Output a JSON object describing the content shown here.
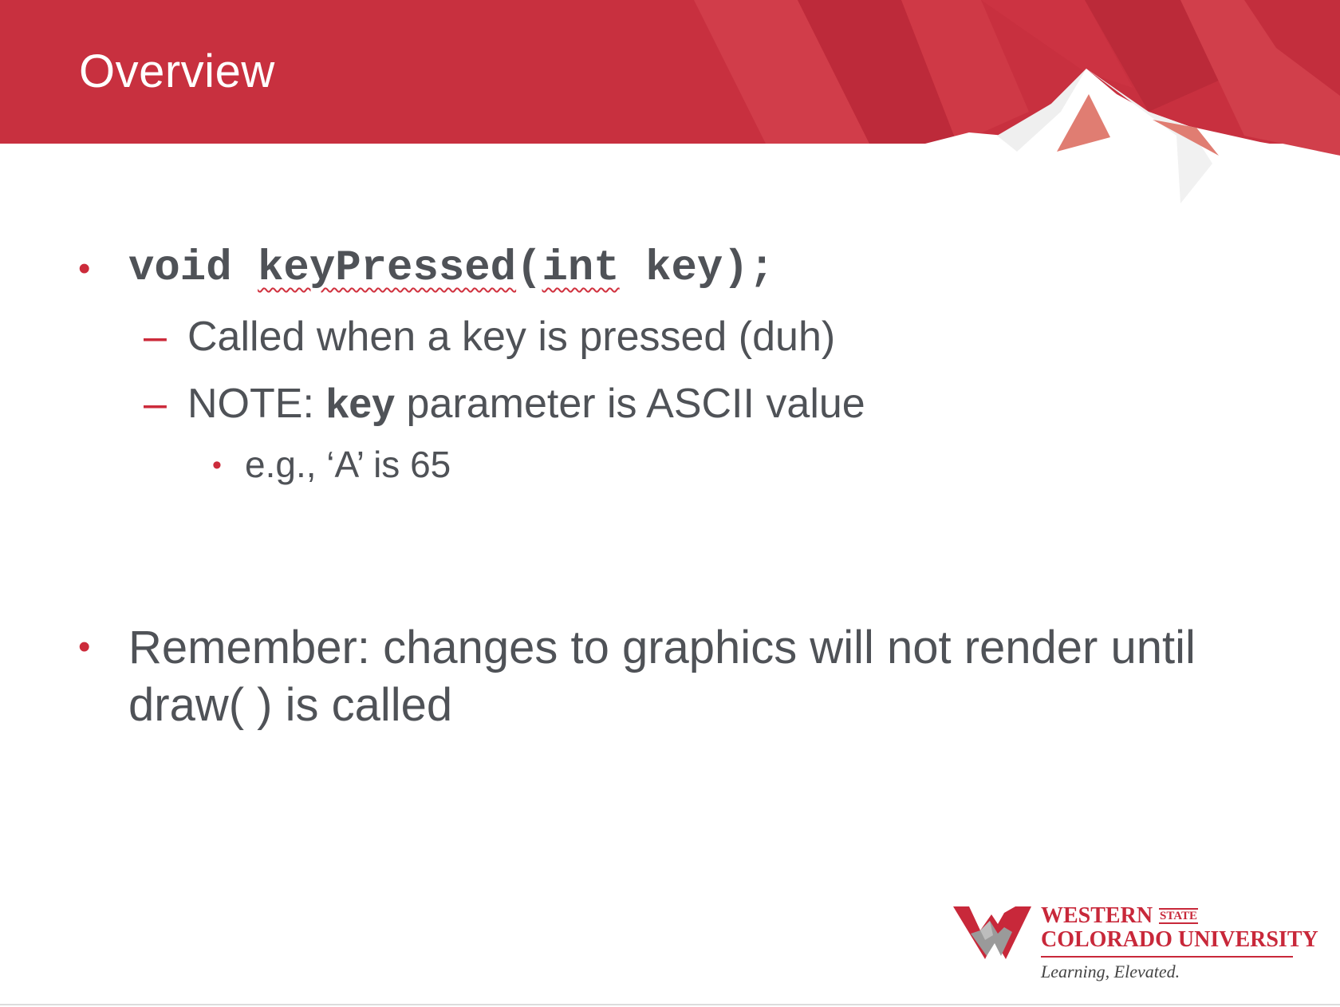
{
  "slide": {
    "title": "Overview",
    "bullets": [
      {
        "code_prefix": "void ",
        "code_fn": "keyPressed",
        "code_paren": "(",
        "code_type": "int",
        "code_rest": " key);",
        "subitems": [
          {
            "text": "Called when a key is pressed (duh)"
          },
          {
            "prefix": "NOTE: ",
            "bold": "key",
            "suffix": " parameter is ASCII value",
            "subitems": [
              {
                "text": "e.g., ‘A’ is 65"
              }
            ]
          }
        ]
      },
      {
        "text": "Remember: changes to graphics will not render until draw( ) is called"
      }
    ],
    "bullet_char": "•",
    "dash_char": "–"
  },
  "logo": {
    "line1": "WESTERN",
    "state": "STATE",
    "line2": "COLORADO UNIVERSITY",
    "tagline": "Learning, Elevated."
  },
  "colors": {
    "header_red": "#c8303f",
    "accent_red": "#cc2b3b",
    "text_gray": "#4f5257"
  }
}
